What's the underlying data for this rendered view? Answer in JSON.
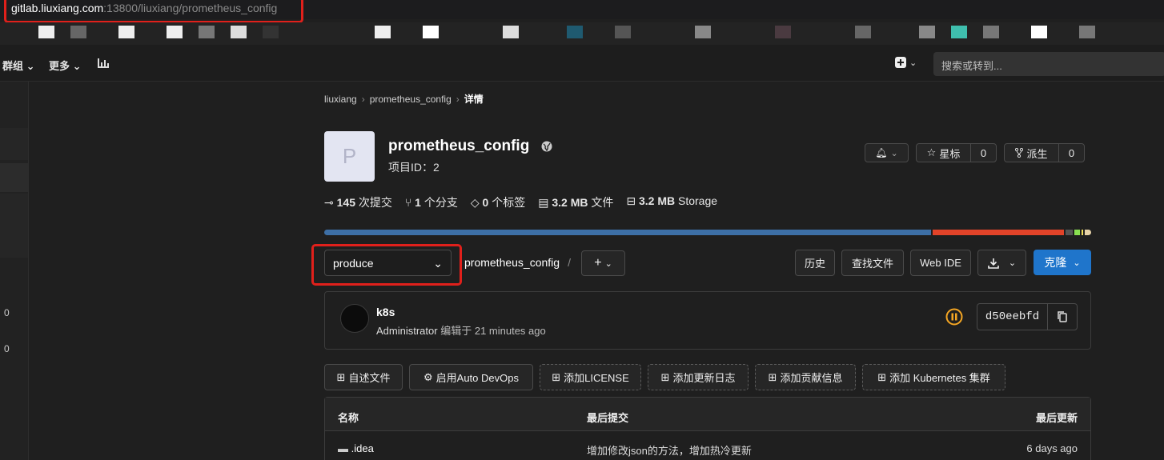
{
  "browser": {
    "url_host": "gitlab.liuxiang.com",
    "url_rest": ":13800/liuxiang/prometheus_config"
  },
  "nav": {
    "groups_label": "群组",
    "more_label": "更多",
    "search_placeholder": "搜索或转到..."
  },
  "sidebar": {
    "counts": [
      "0",
      "0"
    ]
  },
  "breadcrumb": [
    "liuxiang",
    "prometheus_config",
    "详情"
  ],
  "project": {
    "avatar_letter": "P",
    "name": "prometheus_config",
    "id_label": "项目ID：",
    "id_value": "2",
    "star_label": "星标",
    "star_count": "0",
    "fork_label": "派生",
    "fork_count": "0"
  },
  "stats": {
    "commits_value": "145",
    "commits_label": "次提交",
    "branches_value": "1",
    "branches_label": "个分支",
    "tags_value": "0",
    "tags_label": "个标签",
    "files_value": "3.2 MB",
    "files_label": "文件",
    "storage_value": "3.2 MB",
    "storage_label": "Storage"
  },
  "languages": [
    {
      "color": "#3d6fa6",
      "share": 80
    },
    {
      "color": "#e24329",
      "share": 17.3
    },
    {
      "color": "#555555",
      "share": 0.9
    },
    {
      "color": "#89e051",
      "share": 0.7
    },
    {
      "color": "#f1e05a",
      "share": 0.3
    },
    {
      "color": "#e7d3a8",
      "share": 0.8
    }
  ],
  "repo": {
    "branch": "produce",
    "path": "prometheus_config",
    "history_label": "历史",
    "find_file_label": "查找文件",
    "web_ide_label": "Web IDE",
    "clone_label": "克隆"
  },
  "last_commit": {
    "title": "k8s",
    "author": "Administrator",
    "edited_label": "编辑于",
    "time": "21 minutes ago",
    "sha": "d50eebfd"
  },
  "actions": {
    "readme": "自述文件",
    "auto_devops": "启用Auto DevOps",
    "add_license": "添加LICENSE",
    "add_changelog": "添加更新日志",
    "add_contributing": "添加贡献信息",
    "add_k8s": "添加 Kubernetes 集群"
  },
  "table": {
    "col_name": "名称",
    "col_last_commit": "最后提交",
    "col_last_update": "最后更新",
    "rows": [
      {
        "name": ".idea",
        "commit": "增加修改json的方法，增加热冷更新",
        "updated": "6 days ago"
      }
    ]
  },
  "colors": {
    "accent": "#1f75cb",
    "highlight": "#e0201b",
    "pipeline": "#f5a623"
  }
}
